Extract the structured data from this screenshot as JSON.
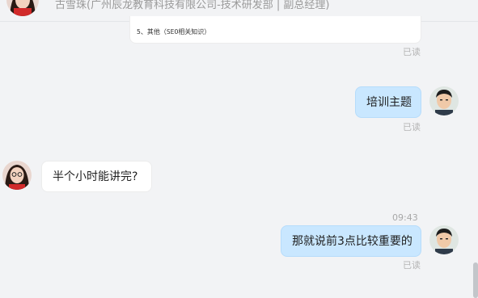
{
  "header": {
    "contact_name": "古雪珠(广州辰龙教育科技有限公司-技术研发部 | 副总经理)"
  },
  "messages": [
    {
      "doc_preview_line": "5、其他（SEO相关知识）",
      "read_label": "已读"
    },
    {
      "text": "培训主题",
      "read_label": "已读"
    },
    {
      "text": "半个小时能讲完?"
    },
    {
      "timestamp": "09:43",
      "text": "那就说前3点比较重要的",
      "read_label": "已读"
    }
  ],
  "colors": {
    "background": "#f2f3f5",
    "mine_bubble": "#c9e7ff",
    "their_bubble": "#ffffff",
    "read_text": "#b5b5b5"
  },
  "icons": {
    "contact_avatar": "avatar-female",
    "my_avatar": "avatar-male"
  }
}
